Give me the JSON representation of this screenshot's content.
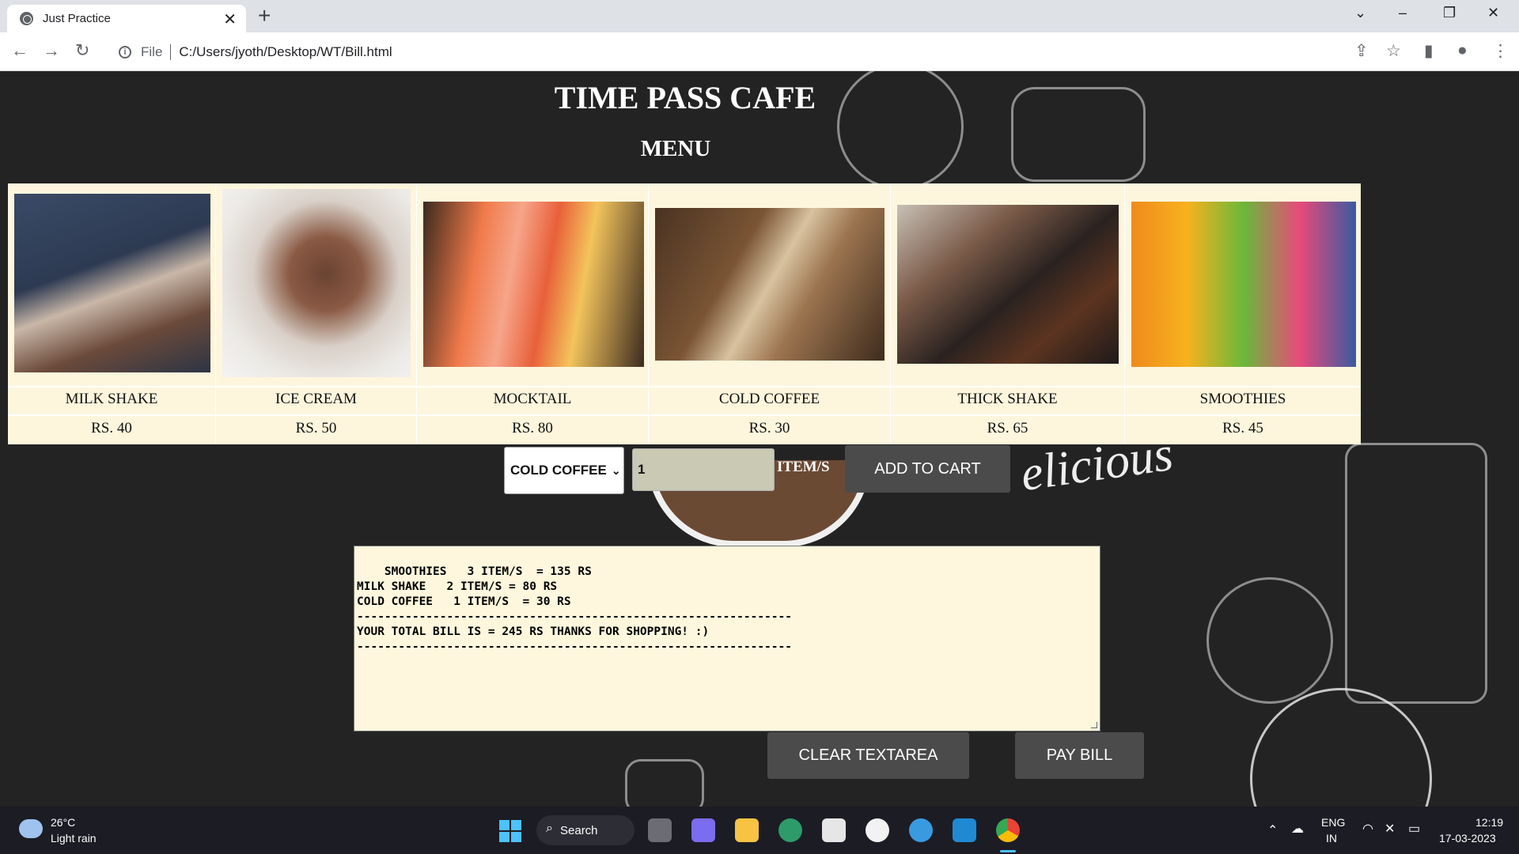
{
  "browser": {
    "tab_title": "Just Practice",
    "file_label": "File",
    "url": "C:/Users/jyoth/Desktop/WT/Bill.html"
  },
  "page": {
    "title": "TIME PASS CAFE",
    "menu_heading": "MENU",
    "items": [
      {
        "name": "MILK SHAKE",
        "price": "RS. 40"
      },
      {
        "name": "ICE CREAM",
        "price": "RS. 50"
      },
      {
        "name": "MOCKTAIL",
        "price": "RS. 80"
      },
      {
        "name": "COLD COFFEE",
        "price": "RS. 30"
      },
      {
        "name": "THICK SHAKE",
        "price": "RS. 65"
      },
      {
        "name": "SMOOTHIES",
        "price": "RS. 45"
      }
    ],
    "order": {
      "selected_item": "COLD COFFEE",
      "quantity": "1",
      "quantity_label": "ITEM/S",
      "add_button": "ADD TO CART"
    },
    "bill_text": "SMOOTHIES   3 ITEM/S  = 135 RS\nMILK SHAKE   2 ITEM/S = 80 RS\nCOLD COFFEE   1 ITEM/S  = 30 RS\n---------------------------------------------------------------\nYOUR TOTAL BILL IS = 245 RS THANKS FOR SHOPPING! :)\n---------------------------------------------------------------",
    "clear_button": "CLEAR TEXTAREA",
    "pay_button": "PAY BILL",
    "background_word": "elicious"
  },
  "taskbar": {
    "weather_temp": "26°C",
    "weather_desc": "Light rain",
    "search_label": "Search",
    "lang_top": "ENG",
    "lang_bottom": "IN",
    "time": "12:19",
    "date": "17-03-2023"
  },
  "colors": {
    "menu_bg": "#fdf6dd",
    "page_bg": "#232323",
    "button_bg": "#4b4b4b"
  }
}
